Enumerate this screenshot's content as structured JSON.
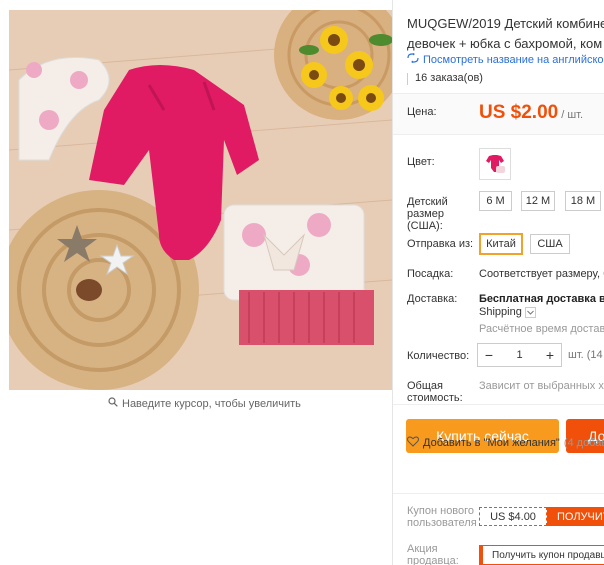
{
  "gallery": {
    "zoom_hint": "Наведите курсор, чтобы увеличить"
  },
  "product": {
    "title_line1": "MUQGEW/2019 Детский комбине",
    "title_line2": "девочек + юбка с бахромой, ком",
    "translate_link": "Посмотреть название на английско",
    "orders": "16 заказа(ов)"
  },
  "price": {
    "label": "Цена:",
    "value": "US $2.00",
    "unit": "/ шт."
  },
  "color": {
    "label": "Цвет:"
  },
  "size": {
    "label_line1": "Детский",
    "label_line2": "размер",
    "label_line3": "(США):",
    "options": [
      "6 M",
      "12 M",
      "18 M"
    ]
  },
  "ship_from": {
    "label": "Отправка из:",
    "options": [
      "Китай",
      "США"
    ],
    "selected": "Китай"
  },
  "fit": {
    "label": "Посадка:",
    "value": "Соответствует размеру, бе"
  },
  "delivery": {
    "label": "Доставка:",
    "value": "Бесплатная доставка в R",
    "method": "Shipping",
    "estimate": "Расчётное время доставки"
  },
  "quantity": {
    "label": "Количество:",
    "value": "1",
    "minus": "−",
    "plus": "+",
    "unit": "шт. (14"
  },
  "total": {
    "label_line1": "Общая",
    "label_line2": "стоимость:",
    "value": "Зависит от выбранных хар"
  },
  "actions": {
    "buy_now": "Купить сейчас",
    "add_to_cart": "До",
    "wishlist": "Добавить в \"Мои желания\"",
    "wishlist_count": "(4 добавл"
  },
  "coupons": {
    "new_user_label_line1": "Купон нового",
    "new_user_label_line2": "пользователя",
    "new_user_amount": "US $4.00",
    "get_button": "ПОЛУЧИТЕ",
    "seller_label_line1": "Акция",
    "seller_label_line2": "продавца:",
    "seller_button": "Получить купон продавц"
  },
  "colors": {
    "accent_orange": "#f79a1e",
    "accent_red": "#f0500a",
    "link_blue": "#2a6fdb"
  }
}
